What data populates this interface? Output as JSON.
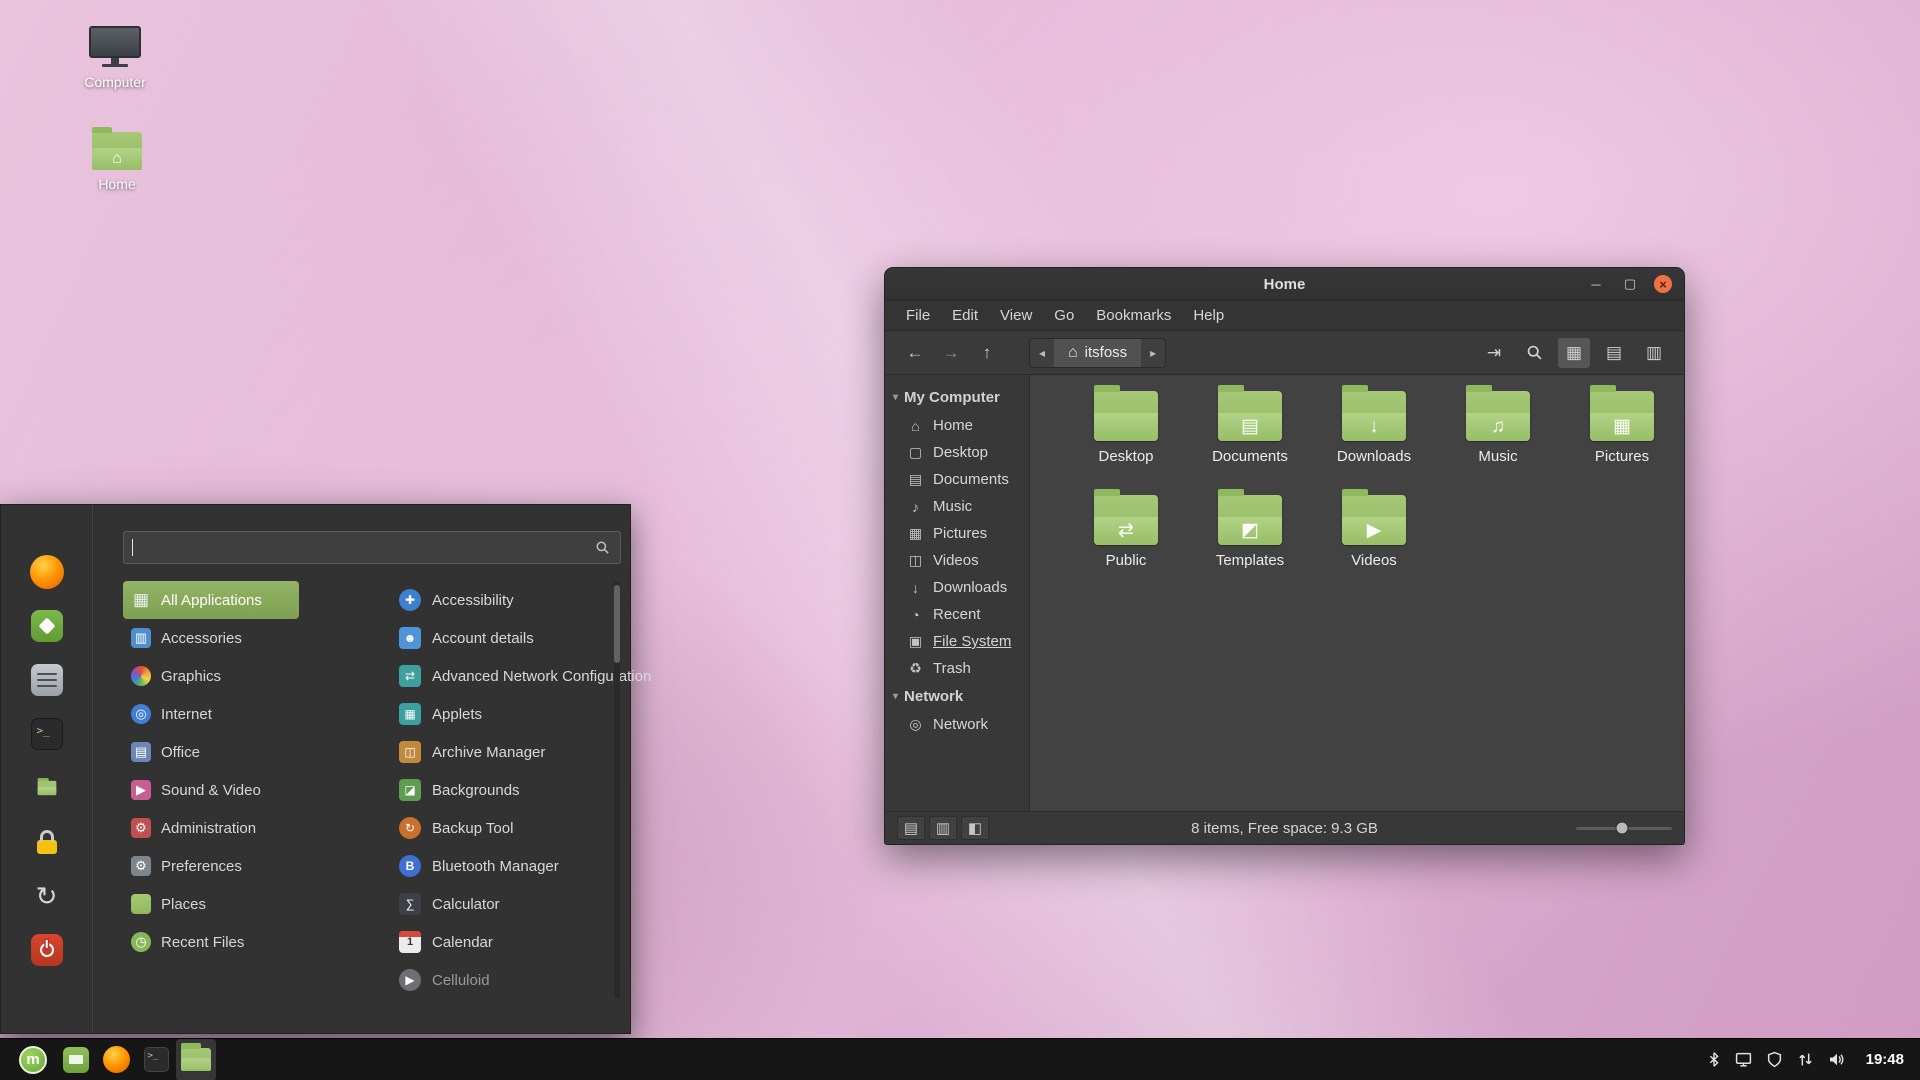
{
  "desktop": {
    "icons": [
      {
        "label": "Computer",
        "icon": "computer-icon"
      },
      {
        "label": "Home",
        "icon": "home-folder-icon",
        "glyph": "⌂"
      }
    ]
  },
  "window": {
    "title": "Home",
    "controls": {
      "minimize": "─",
      "maximize": "▢",
      "close": "×"
    },
    "menubar": [
      {
        "label": "File"
      },
      {
        "label": "Edit"
      },
      {
        "label": "View"
      },
      {
        "label": "Go"
      },
      {
        "label": "Bookmarks"
      },
      {
        "label": "Help"
      }
    ],
    "toolbar": {
      "back": "←",
      "forward": "→",
      "up": "↑",
      "path_prev": "◂",
      "path_next": "▸",
      "path_home_glyph": "⌂",
      "path_segment": "itsfoss",
      "location_glyph": "⇥",
      "view_grid_glyph": "▦",
      "view_list_glyph": "▤",
      "view_compact_glyph": "▥"
    },
    "sidebar": [
      {
        "title": "My Computer",
        "caret": "▾",
        "items": [
          {
            "label": "Home",
            "glyph": "⌂",
            "icon": "home-icon"
          },
          {
            "label": "Desktop",
            "glyph": "▢",
            "icon": "desktop-icon"
          },
          {
            "label": "Documents",
            "glyph": "▤",
            "icon": "documents-icon"
          },
          {
            "label": "Music",
            "glyph": "♪",
            "icon": "music-icon"
          },
          {
            "label": "Pictures",
            "glyph": "▦",
            "icon": "pictures-icon"
          },
          {
            "label": "Videos",
            "glyph": "◫",
            "icon": "videos-icon"
          },
          {
            "label": "Downloads",
            "glyph": "↓",
            "icon": "downloads-icon"
          },
          {
            "label": "Recent",
            "glyph": "◔",
            "icon": "recent-icon"
          },
          {
            "label": "File System",
            "glyph": "▣",
            "icon": "filesystem-icon"
          },
          {
            "label": "Trash",
            "glyph": "♻",
            "icon": "trash-icon"
          }
        ]
      },
      {
        "title": "Network",
        "caret": "▾",
        "items": [
          {
            "label": "Network",
            "glyph": "◎",
            "icon": "network-icon"
          }
        ]
      }
    ],
    "files": [
      {
        "label": "Desktop",
        "emblem": ""
      },
      {
        "label": "Documents",
        "emblem": "▤"
      },
      {
        "label": "Downloads",
        "emblem": "↓"
      },
      {
        "label": "Music",
        "emblem": "♫"
      },
      {
        "label": "Pictures",
        "emblem": "▦"
      },
      {
        "label": "Public",
        "emblem": "⇄"
      },
      {
        "label": "Templates",
        "emblem": "◩"
      },
      {
        "label": "Videos",
        "emblem": "▶"
      }
    ],
    "statusbar": {
      "text": "8 items, Free space: 9.3 GB",
      "toggles": [
        {
          "glyph": "▤"
        },
        {
          "glyph": "▥"
        },
        {
          "glyph": "◧"
        }
      ]
    }
  },
  "menu": {
    "search": {
      "value": "",
      "placeholder": ""
    },
    "categories": [
      {
        "label": "All Applications",
        "glyph": "▦",
        "icon": "all-applications-icon"
      },
      {
        "label": "Accessories",
        "glyph": "▥",
        "icon": "accessories-icon"
      },
      {
        "label": "Graphics",
        "glyph": "",
        "icon": "graphics-icon"
      },
      {
        "label": "Internet",
        "glyph": "◎",
        "icon": "internet-icon"
      },
      {
        "label": "Office",
        "glyph": "▤",
        "icon": "office-icon"
      },
      {
        "label": "Sound & Video",
        "glyph": "▶",
        "icon": "sound-video-icon"
      },
      {
        "label": "Administration",
        "glyph": "⚙",
        "icon": "administration-icon"
      },
      {
        "label": "Preferences",
        "glyph": "⚙",
        "icon": "preferences-icon"
      },
      {
        "label": "Places",
        "glyph": "",
        "icon": "places-icon"
      },
      {
        "label": "Recent Files",
        "glyph": "◷",
        "icon": "recent-files-icon"
      }
    ],
    "apps": [
      {
        "label": "Accessibility",
        "glyph": "✚",
        "icon": "accessibility-icon"
      },
      {
        "label": "Account details",
        "glyph": "☻",
        "icon": "account-details-icon"
      },
      {
        "label": "Advanced Network Configuration",
        "glyph": "⇄",
        "icon": "network-config-icon"
      },
      {
        "label": "Applets",
        "glyph": "▦",
        "icon": "applets-icon"
      },
      {
        "label": "Archive Manager",
        "glyph": "◫",
        "icon": "archive-manager-icon"
      },
      {
        "label": "Backgrounds",
        "glyph": "◪",
        "icon": "backgrounds-icon"
      },
      {
        "label": "Backup Tool",
        "glyph": "↻",
        "icon": "backup-tool-icon"
      },
      {
        "label": "Bluetooth Manager",
        "glyph": "B",
        "icon": "bluetooth-manager-icon"
      },
      {
        "label": "Calculator",
        "glyph": "∑",
        "icon": "calculator-icon"
      },
      {
        "label": "Calendar",
        "glyph": "1",
        "icon": "calendar-icon"
      },
      {
        "label": "Celluloid",
        "glyph": "▶",
        "icon": "celluloid-icon"
      }
    ],
    "terminal_prompt": ">_"
  },
  "panel": {
    "time": "19:48",
    "mint_logo_letter": "m",
    "terminal_prompt": ">_"
  }
}
